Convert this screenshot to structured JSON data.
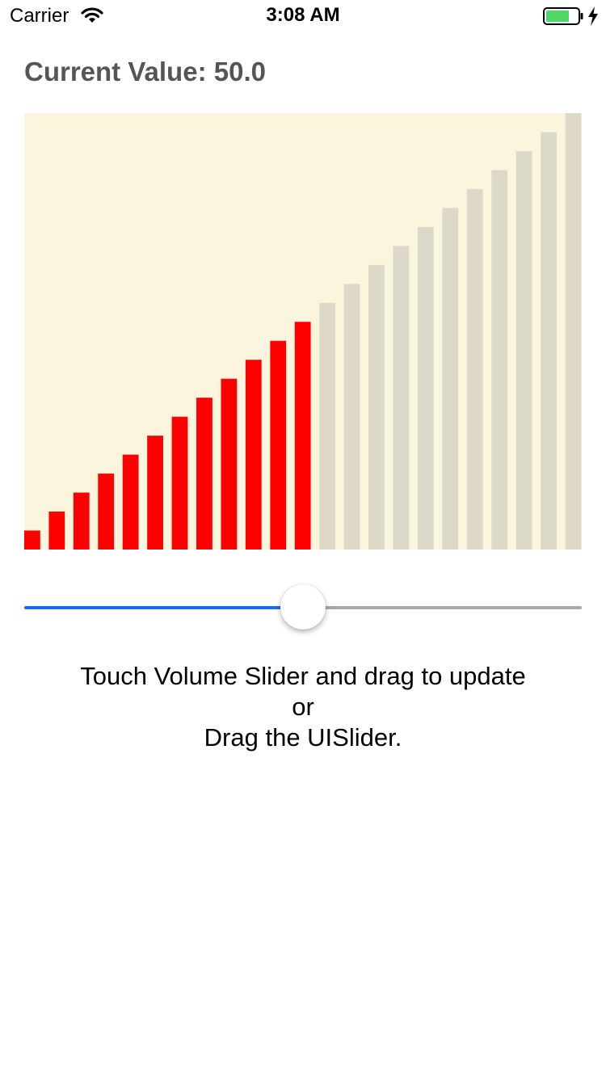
{
  "status_bar": {
    "carrier": "Carrier",
    "time": "3:08 AM",
    "battery_color": "#4cd964"
  },
  "header": {
    "label": "Current Value:",
    "value": "50.0"
  },
  "chart_data": {
    "type": "bar",
    "bar_count": 23,
    "current_value": 50.0,
    "max_value": 100.0,
    "active_bars": 12,
    "active_color": "#ff0000",
    "inactive_color": "#dcd9c8",
    "background_color": "#fbf5de"
  },
  "slider": {
    "value": 50.0,
    "min": 0,
    "max": 100,
    "min_track_color": "#1a6cf0",
    "max_track_color": "#a9a9a9"
  },
  "instructions": {
    "line1": "Touch Volume Slider and drag to update",
    "line2": "or",
    "line3": "Drag the UISlider."
  }
}
